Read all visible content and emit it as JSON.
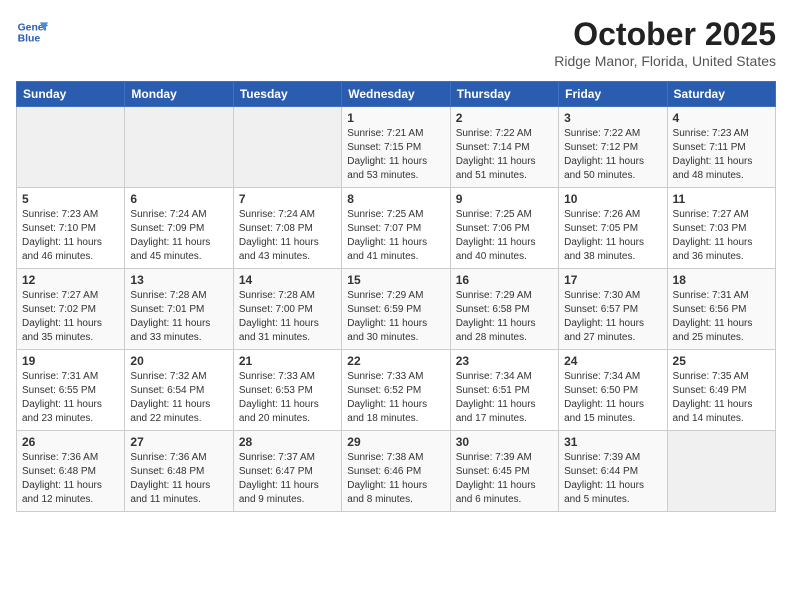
{
  "logo": {
    "line1": "General",
    "line2": "Blue"
  },
  "title": "October 2025",
  "location": "Ridge Manor, Florida, United States",
  "days_of_week": [
    "Sunday",
    "Monday",
    "Tuesday",
    "Wednesday",
    "Thursday",
    "Friday",
    "Saturday"
  ],
  "weeks": [
    [
      {
        "day": "",
        "info": ""
      },
      {
        "day": "",
        "info": ""
      },
      {
        "day": "",
        "info": ""
      },
      {
        "day": "1",
        "info": "Sunrise: 7:21 AM\nSunset: 7:15 PM\nDaylight: 11 hours and 53 minutes."
      },
      {
        "day": "2",
        "info": "Sunrise: 7:22 AM\nSunset: 7:14 PM\nDaylight: 11 hours and 51 minutes."
      },
      {
        "day": "3",
        "info": "Sunrise: 7:22 AM\nSunset: 7:12 PM\nDaylight: 11 hours and 50 minutes."
      },
      {
        "day": "4",
        "info": "Sunrise: 7:23 AM\nSunset: 7:11 PM\nDaylight: 11 hours and 48 minutes."
      }
    ],
    [
      {
        "day": "5",
        "info": "Sunrise: 7:23 AM\nSunset: 7:10 PM\nDaylight: 11 hours and 46 minutes."
      },
      {
        "day": "6",
        "info": "Sunrise: 7:24 AM\nSunset: 7:09 PM\nDaylight: 11 hours and 45 minutes."
      },
      {
        "day": "7",
        "info": "Sunrise: 7:24 AM\nSunset: 7:08 PM\nDaylight: 11 hours and 43 minutes."
      },
      {
        "day": "8",
        "info": "Sunrise: 7:25 AM\nSunset: 7:07 PM\nDaylight: 11 hours and 41 minutes."
      },
      {
        "day": "9",
        "info": "Sunrise: 7:25 AM\nSunset: 7:06 PM\nDaylight: 11 hours and 40 minutes."
      },
      {
        "day": "10",
        "info": "Sunrise: 7:26 AM\nSunset: 7:05 PM\nDaylight: 11 hours and 38 minutes."
      },
      {
        "day": "11",
        "info": "Sunrise: 7:27 AM\nSunset: 7:03 PM\nDaylight: 11 hours and 36 minutes."
      }
    ],
    [
      {
        "day": "12",
        "info": "Sunrise: 7:27 AM\nSunset: 7:02 PM\nDaylight: 11 hours and 35 minutes."
      },
      {
        "day": "13",
        "info": "Sunrise: 7:28 AM\nSunset: 7:01 PM\nDaylight: 11 hours and 33 minutes."
      },
      {
        "day": "14",
        "info": "Sunrise: 7:28 AM\nSunset: 7:00 PM\nDaylight: 11 hours and 31 minutes."
      },
      {
        "day": "15",
        "info": "Sunrise: 7:29 AM\nSunset: 6:59 PM\nDaylight: 11 hours and 30 minutes."
      },
      {
        "day": "16",
        "info": "Sunrise: 7:29 AM\nSunset: 6:58 PM\nDaylight: 11 hours and 28 minutes."
      },
      {
        "day": "17",
        "info": "Sunrise: 7:30 AM\nSunset: 6:57 PM\nDaylight: 11 hours and 27 minutes."
      },
      {
        "day": "18",
        "info": "Sunrise: 7:31 AM\nSunset: 6:56 PM\nDaylight: 11 hours and 25 minutes."
      }
    ],
    [
      {
        "day": "19",
        "info": "Sunrise: 7:31 AM\nSunset: 6:55 PM\nDaylight: 11 hours and 23 minutes."
      },
      {
        "day": "20",
        "info": "Sunrise: 7:32 AM\nSunset: 6:54 PM\nDaylight: 11 hours and 22 minutes."
      },
      {
        "day": "21",
        "info": "Sunrise: 7:33 AM\nSunset: 6:53 PM\nDaylight: 11 hours and 20 minutes."
      },
      {
        "day": "22",
        "info": "Sunrise: 7:33 AM\nSunset: 6:52 PM\nDaylight: 11 hours and 18 minutes."
      },
      {
        "day": "23",
        "info": "Sunrise: 7:34 AM\nSunset: 6:51 PM\nDaylight: 11 hours and 17 minutes."
      },
      {
        "day": "24",
        "info": "Sunrise: 7:34 AM\nSunset: 6:50 PM\nDaylight: 11 hours and 15 minutes."
      },
      {
        "day": "25",
        "info": "Sunrise: 7:35 AM\nSunset: 6:49 PM\nDaylight: 11 hours and 14 minutes."
      }
    ],
    [
      {
        "day": "26",
        "info": "Sunrise: 7:36 AM\nSunset: 6:48 PM\nDaylight: 11 hours and 12 minutes."
      },
      {
        "day": "27",
        "info": "Sunrise: 7:36 AM\nSunset: 6:48 PM\nDaylight: 11 hours and 11 minutes."
      },
      {
        "day": "28",
        "info": "Sunrise: 7:37 AM\nSunset: 6:47 PM\nDaylight: 11 hours and 9 minutes."
      },
      {
        "day": "29",
        "info": "Sunrise: 7:38 AM\nSunset: 6:46 PM\nDaylight: 11 hours and 8 minutes."
      },
      {
        "day": "30",
        "info": "Sunrise: 7:39 AM\nSunset: 6:45 PM\nDaylight: 11 hours and 6 minutes."
      },
      {
        "day": "31",
        "info": "Sunrise: 7:39 AM\nSunset: 6:44 PM\nDaylight: 11 hours and 5 minutes."
      },
      {
        "day": "",
        "info": ""
      }
    ]
  ]
}
